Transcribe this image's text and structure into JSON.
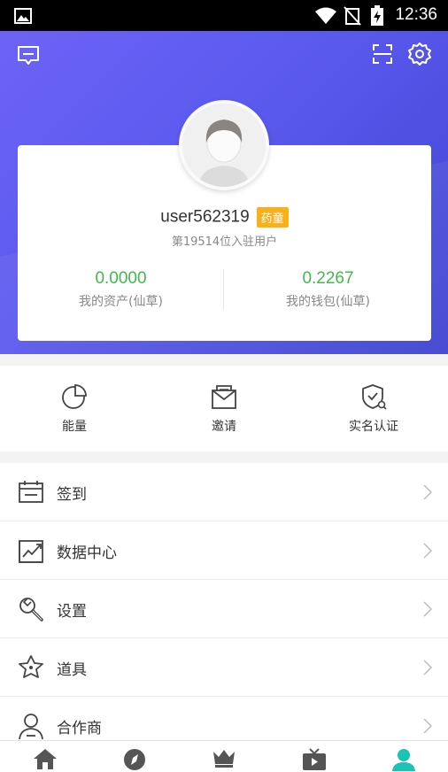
{
  "status_bar": {
    "time": "12:36"
  },
  "profile": {
    "username": "user562319",
    "badge": "药童",
    "subtitle": "第19514位入驻用户"
  },
  "stats": [
    {
      "value": "0.0000",
      "label": "我的资产(仙草)"
    },
    {
      "value": "0.2267",
      "label": "我的钱包(仙草)"
    }
  ],
  "quick_actions": [
    {
      "label": "能量",
      "icon": "pie-chart-icon"
    },
    {
      "label": "邀请",
      "icon": "envelope-icon"
    },
    {
      "label": "实名认证",
      "icon": "shield-check-icon"
    }
  ],
  "menu": [
    {
      "label": "签到",
      "icon": "calendar-icon"
    },
    {
      "label": "数据中心",
      "icon": "trend-chart-icon"
    },
    {
      "label": "设置",
      "icon": "wrench-icon"
    },
    {
      "label": "道具",
      "icon": "star-icon"
    },
    {
      "label": "合作商",
      "icon": "person-icon"
    }
  ],
  "tabs": [
    {
      "icon": "home-icon",
      "active": false
    },
    {
      "icon": "compass-icon",
      "active": false
    },
    {
      "icon": "crown-icon",
      "active": false
    },
    {
      "icon": "tv-icon",
      "active": false
    },
    {
      "icon": "user-icon",
      "active": true
    }
  ],
  "colors": {
    "header_gradient_start": "#6d63f6",
    "header_gradient_end": "#3f44d0",
    "stat_value": "#3fba4a",
    "badge": "#f9b11a",
    "active_tab": "#1bc3b6",
    "inactive_tab": "#555555"
  }
}
